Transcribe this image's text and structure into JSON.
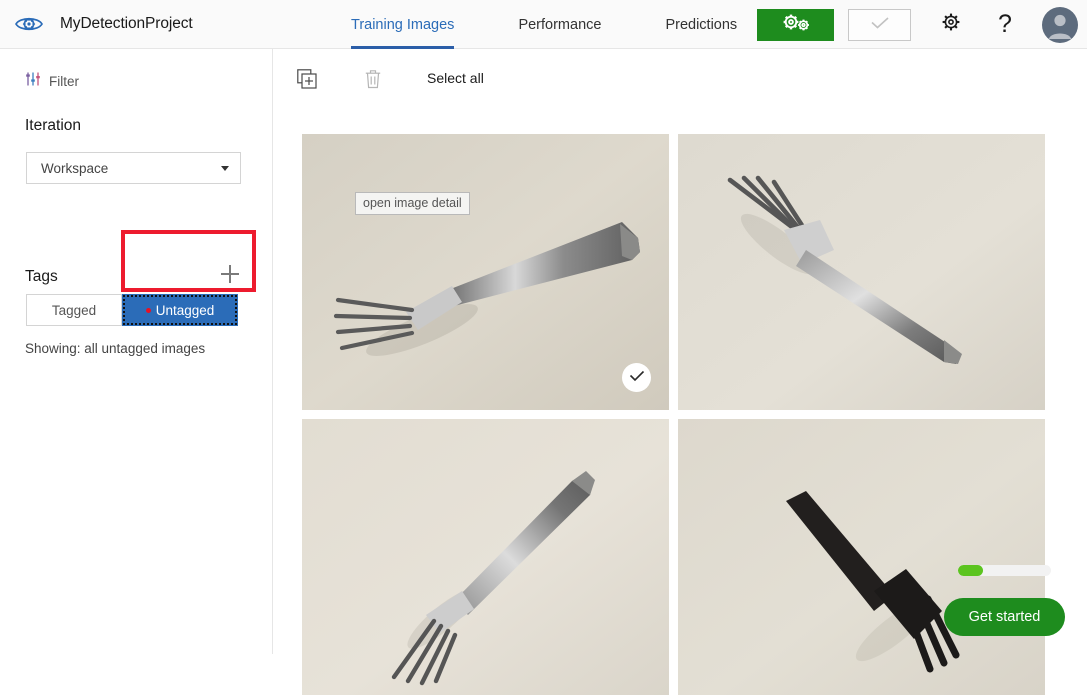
{
  "header": {
    "logo_icon": "eye-gear-logo-icon",
    "project_title": "MyDetectionProject",
    "tabs": [
      {
        "label": "Training Images",
        "active": true
      },
      {
        "label": "Performance",
        "active": false
      },
      {
        "label": "Predictions",
        "active": false
      }
    ],
    "train_button": {
      "icon": "gears-icon",
      "color": "#1e8c1e"
    },
    "quick_test_button": {
      "icon": "check-icon",
      "enabled": false
    },
    "settings_icon": "gear-icon",
    "help_icon": "question-mark-icon",
    "avatar_icon": "user-avatar-icon",
    "accent_color": "#2b6cb8"
  },
  "sidebar": {
    "filter": {
      "icon": "sliders-icon",
      "label": "Filter"
    },
    "iteration_heading": "Iteration",
    "iteration_dropdown": {
      "value": "Workspace",
      "caret_icon": "chevron-down-icon",
      "options": [
        "Workspace"
      ]
    },
    "tags_heading": "Tags",
    "add_tag_icon": "plus-icon",
    "tag_filters": [
      {
        "label": "Tagged",
        "selected": false
      },
      {
        "label": "Untagged",
        "selected": true,
        "dot_color": "#e81123"
      }
    ],
    "showing_text": "Showing: all untagged images",
    "annotation_color": "#ed1b2e"
  },
  "toolbar": {
    "add_images_icon": "add-images-icon",
    "delete_icon": "trash-icon",
    "select_all_label": "Select all"
  },
  "grid": {
    "tooltip_text": "open image detail",
    "items": [
      {
        "alt": "silver fork, tines lower-left handle upper-right, on cream background",
        "selected": true,
        "tooltip_visible": true,
        "check_icon": "check-icon"
      },
      {
        "alt": "silver fork, tines upper-left handle lower-right, on cream background",
        "selected": false,
        "tooltip_visible": false
      },
      {
        "alt": "silver fork, tines lower-left handle upper-right, on cream background",
        "selected": false,
        "tooltip_visible": false
      },
      {
        "alt": "black plastic fork, tines lower-right handle upper-left, on cream background",
        "selected": false,
        "tooltip_visible": false
      }
    ]
  },
  "floating_widget": {
    "progress_percent": 27,
    "progress_fill_color": "#5cc41f",
    "get_started_label": "Get started",
    "get_started_color": "#1e8c1e"
  }
}
